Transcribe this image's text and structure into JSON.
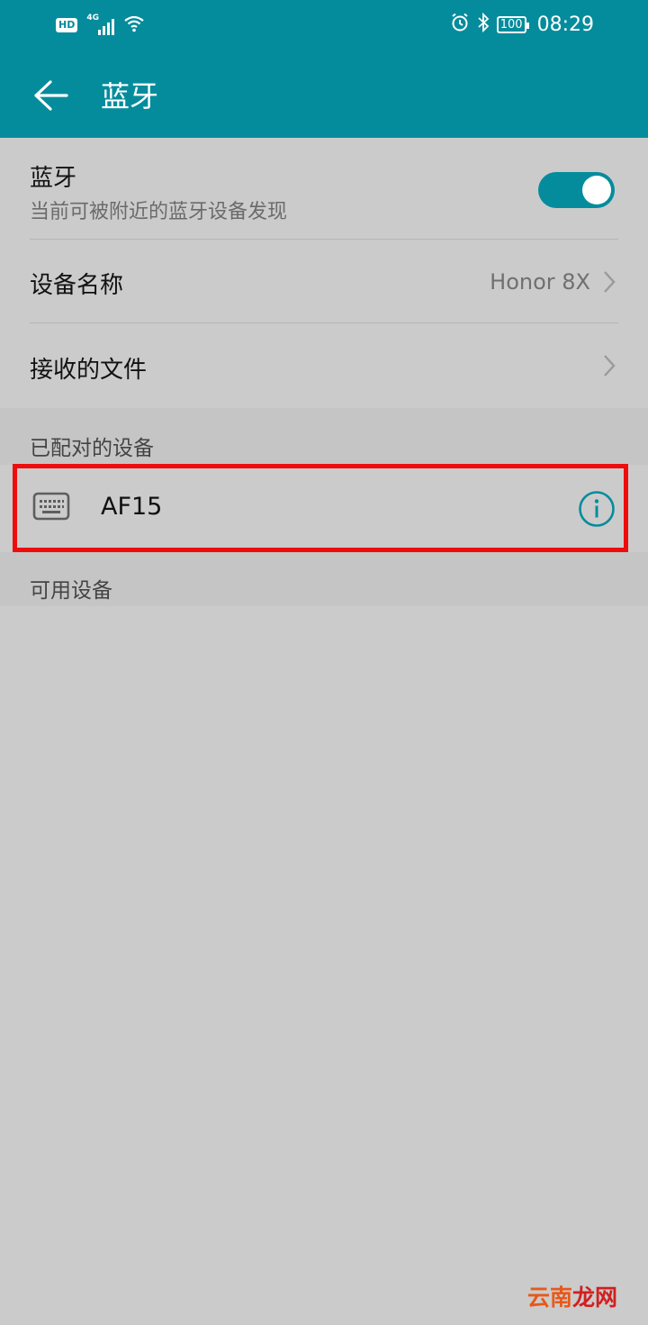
{
  "status_bar": {
    "hd": "HD",
    "network": "4G",
    "battery": "100",
    "time": "08:29",
    "icons": [
      "signal-icon",
      "wifi-icon",
      "alarm-icon",
      "bluetooth-icon",
      "battery-icon"
    ]
  },
  "app_bar": {
    "title": "蓝牙",
    "back_icon": "back-arrow-icon"
  },
  "bluetooth_toggle": {
    "title": "蓝牙",
    "subtitle": "当前可被附近的蓝牙设备发现",
    "enabled": true
  },
  "device_name": {
    "label": "设备名称",
    "value": "Honor 8X"
  },
  "received_files": {
    "label": "接收的文件"
  },
  "paired_section": {
    "label": "已配对的设备",
    "devices": [
      {
        "name": "AF15",
        "icon": "keyboard-icon",
        "action_icon": "info-icon"
      }
    ]
  },
  "available_section": {
    "label": "可用设备"
  },
  "watermark": {
    "part1": "云南",
    "part2": "龙网"
  },
  "colors": {
    "accent": "#058c9c",
    "highlight": "#ee0d0d",
    "background": "#cbcbcb"
  }
}
